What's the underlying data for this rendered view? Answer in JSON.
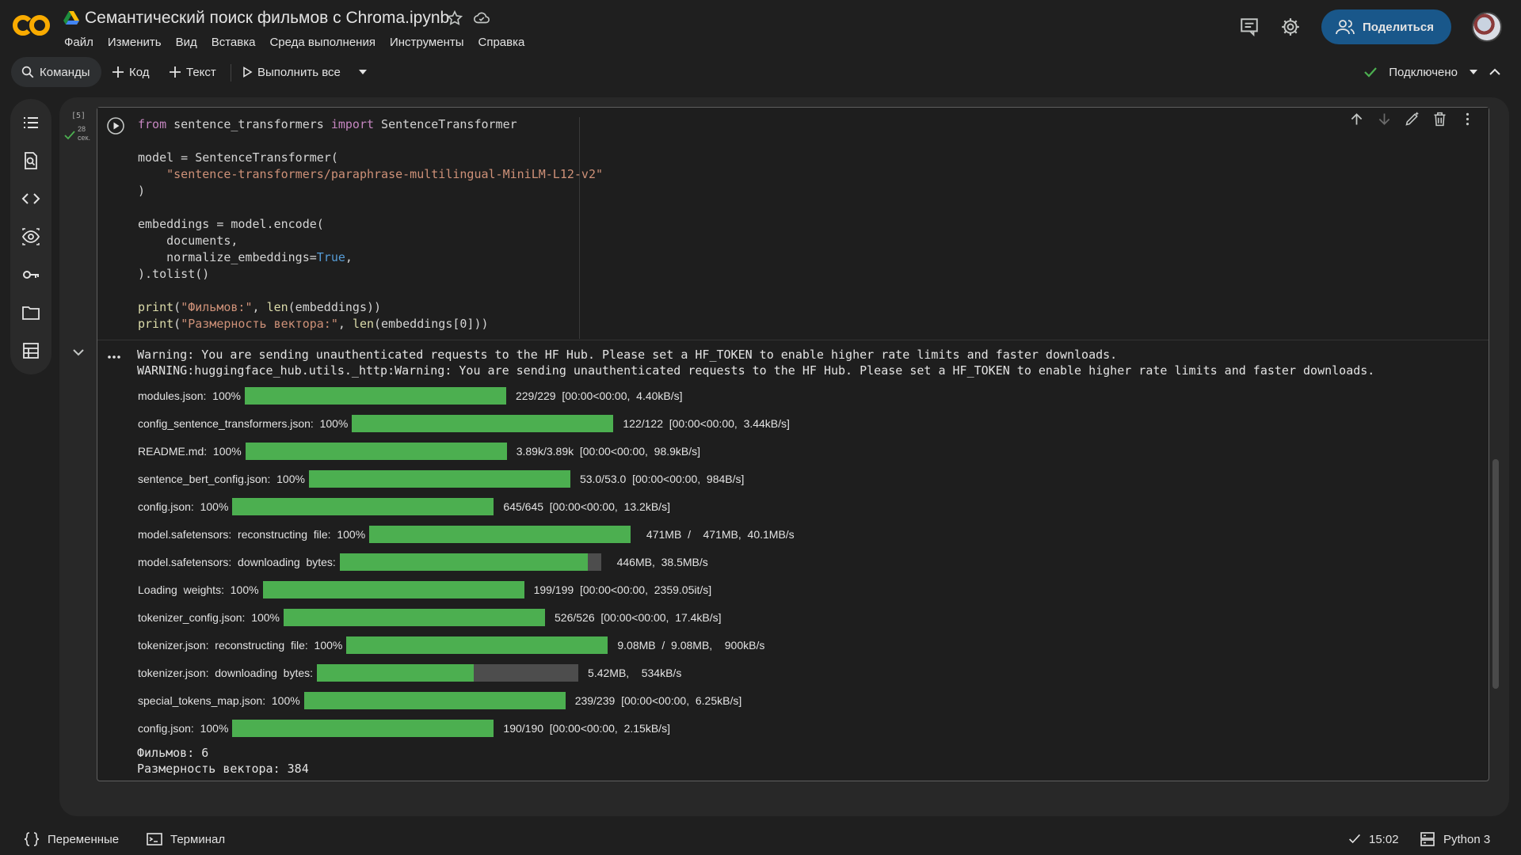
{
  "header": {
    "title": "Семантический поиск фильмов с Chroma.ipynb",
    "menu": [
      "Файл",
      "Изменить",
      "Вид",
      "Вставка",
      "Среда выполнения",
      "Инструменты",
      "Справка"
    ],
    "share_label": "Поделиться"
  },
  "toolbar": {
    "commands_label": "Команды",
    "code_label": "Код",
    "text_label": "Текст",
    "run_all_label": "Выполнить все",
    "connected_label": "Подключено"
  },
  "cell": {
    "exec_count": "[5]",
    "exec_time_value": "28",
    "exec_time_unit": "сек.",
    "code_lines": [
      "from sentence_transformers import SentenceTransformer",
      "",
      "model = SentenceTransformer(",
      "    \"sentence-transformers/paraphrase-multilingual-MiniLM-L12-v2\"",
      ")",
      "",
      "embeddings = model.encode(",
      "    documents,",
      "    normalize_embeddings=True,",
      ").tolist()",
      "",
      "print(\"Фильмов:\", len(embeddings))",
      "print(\"Размерность вектора:\", len(embeddings[0]))"
    ],
    "output": {
      "warning_lines": [
        "Warning: You are sending unauthenticated requests to the HF Hub. Please set a HF_TOKEN to enable higher rate limits and faster downloads.",
        "WARNING:huggingface_hub.utils._http:Warning: You are sending unauthenticated requests to the HF Hub. Please set a HF_TOKEN to enable higher rate limits and faster downloads."
      ],
      "progress": [
        {
          "label": "modules.json:  100%",
          "fraction": 1.0,
          "stats": "229/229  [00:00<00:00,  4.40kB/s]"
        },
        {
          "label": "config_sentence_transformers.json:  100%",
          "fraction": 1.0,
          "stats": "122/122  [00:00<00:00,  3.44kB/s]"
        },
        {
          "label": "README.md:  100%",
          "fraction": 1.0,
          "stats": "3.89k/3.89k  [00:00<00:00,  98.9kB/s]"
        },
        {
          "label": "sentence_bert_config.json:  100%",
          "fraction": 1.0,
          "stats": "53.0/53.0  [00:00<00:00,  984B/s]"
        },
        {
          "label": "config.json:  100%",
          "fraction": 1.0,
          "stats": "645/645  [00:00<00:00,  13.2kB/s]"
        },
        {
          "label": "model.safetensors:  reconstructing  file:  100%",
          "fraction": 1.0,
          "stats": "  471MB  /    471MB,  40.1MB/s"
        },
        {
          "label": "model.safetensors:  downloading  bytes:",
          "fraction": 0.95,
          "stats": "  446MB,  38.5MB/s"
        },
        {
          "label": "Loading  weights:  100%",
          "fraction": 1.0,
          "stats": "199/199  [00:00<00:00,  2359.05it/s]"
        },
        {
          "label": "tokenizer_config.json:  100%",
          "fraction": 1.0,
          "stats": "526/526  [00:00<00:00,  17.4kB/s]"
        },
        {
          "label": "tokenizer.json:  reconstructing  file:  100%",
          "fraction": 1.0,
          "stats": "9.08MB  /  9.08MB,    900kB/s"
        },
        {
          "label": "tokenizer.json:  downloading  bytes:",
          "fraction": 0.6,
          "stats": "5.42MB,    534kB/s"
        },
        {
          "label": "special_tokens_map.json:  100%",
          "fraction": 1.0,
          "stats": "239/239  [00:00<00:00,  6.25kB/s]"
        },
        {
          "label": "config.json:  100%",
          "fraction": 1.0,
          "stats": "190/190  [00:00<00:00,  2.15kB/s]"
        }
      ],
      "final_lines": [
        "Фильмов: 6",
        "Размерность вектора: 384"
      ]
    }
  },
  "status": {
    "variables_label": "Переменные",
    "terminal_label": "Терминал",
    "time": "15:02",
    "runtime": "Python 3"
  },
  "colors": {
    "accent_green": "#4caf50",
    "share_button": "#19578a",
    "background": "#1f1f1f"
  }
}
